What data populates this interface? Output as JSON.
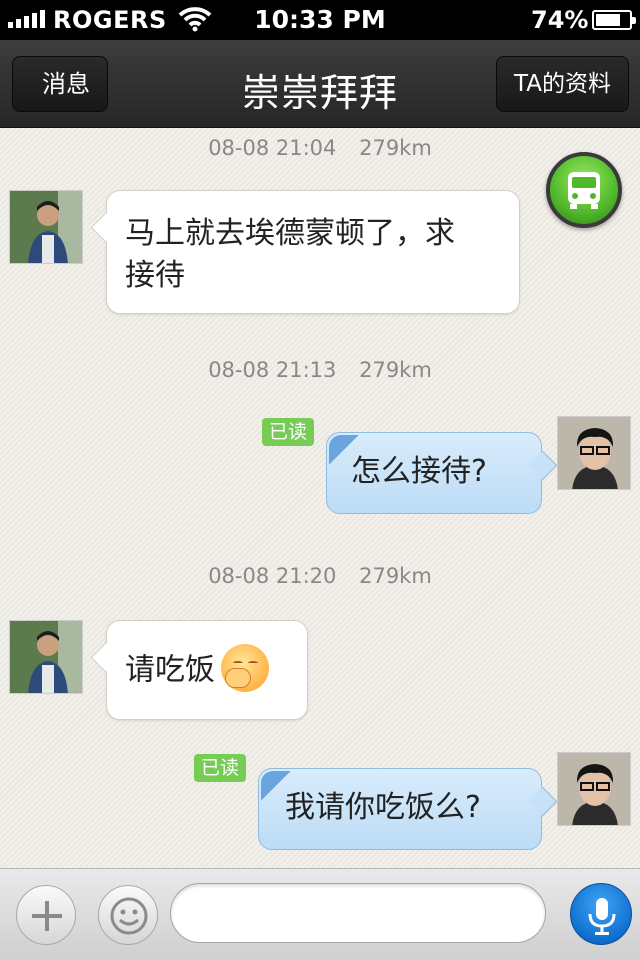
{
  "status_bar": {
    "carrier": "ROGERS",
    "time": "10:33 PM",
    "battery_percent": "74%",
    "battery_level": 0.74,
    "signal_bars": 5
  },
  "nav": {
    "back_label": "消息",
    "title": "崇崇拜拜",
    "profile_label": "TA的资料"
  },
  "messages": [
    {
      "timestamp": "08-08 21:04",
      "distance": "279km",
      "direction": "incoming",
      "text": "马上就去埃德蒙顿了，求",
      "text_line2": "接待",
      "read": ""
    },
    {
      "timestamp": "08-08 21:13",
      "distance": "279km",
      "direction": "outgoing",
      "text": "怎么接待?",
      "read": "已读"
    },
    {
      "timestamp": "08-08 21:20",
      "distance": "279km",
      "direction": "incoming",
      "text": "请吃饭",
      "emoji": "blushing-face",
      "read": ""
    },
    {
      "timestamp": "",
      "distance": "",
      "direction": "outgoing",
      "text": "我请你吃饭么?",
      "read": "已读"
    }
  ],
  "input": {
    "value": "",
    "placeholder": ""
  },
  "icons": {
    "add": "plus-icon",
    "emoji": "smiley-icon",
    "voice": "microphone-icon",
    "transit": "bus-icon"
  },
  "colors": {
    "incoming_bubble": "#ffffff",
    "outgoing_bubble": "#c7e2f8",
    "read_badge": "#77cc55",
    "mic_button": "#0f6fd0",
    "bus_button": "#4fb82b"
  }
}
